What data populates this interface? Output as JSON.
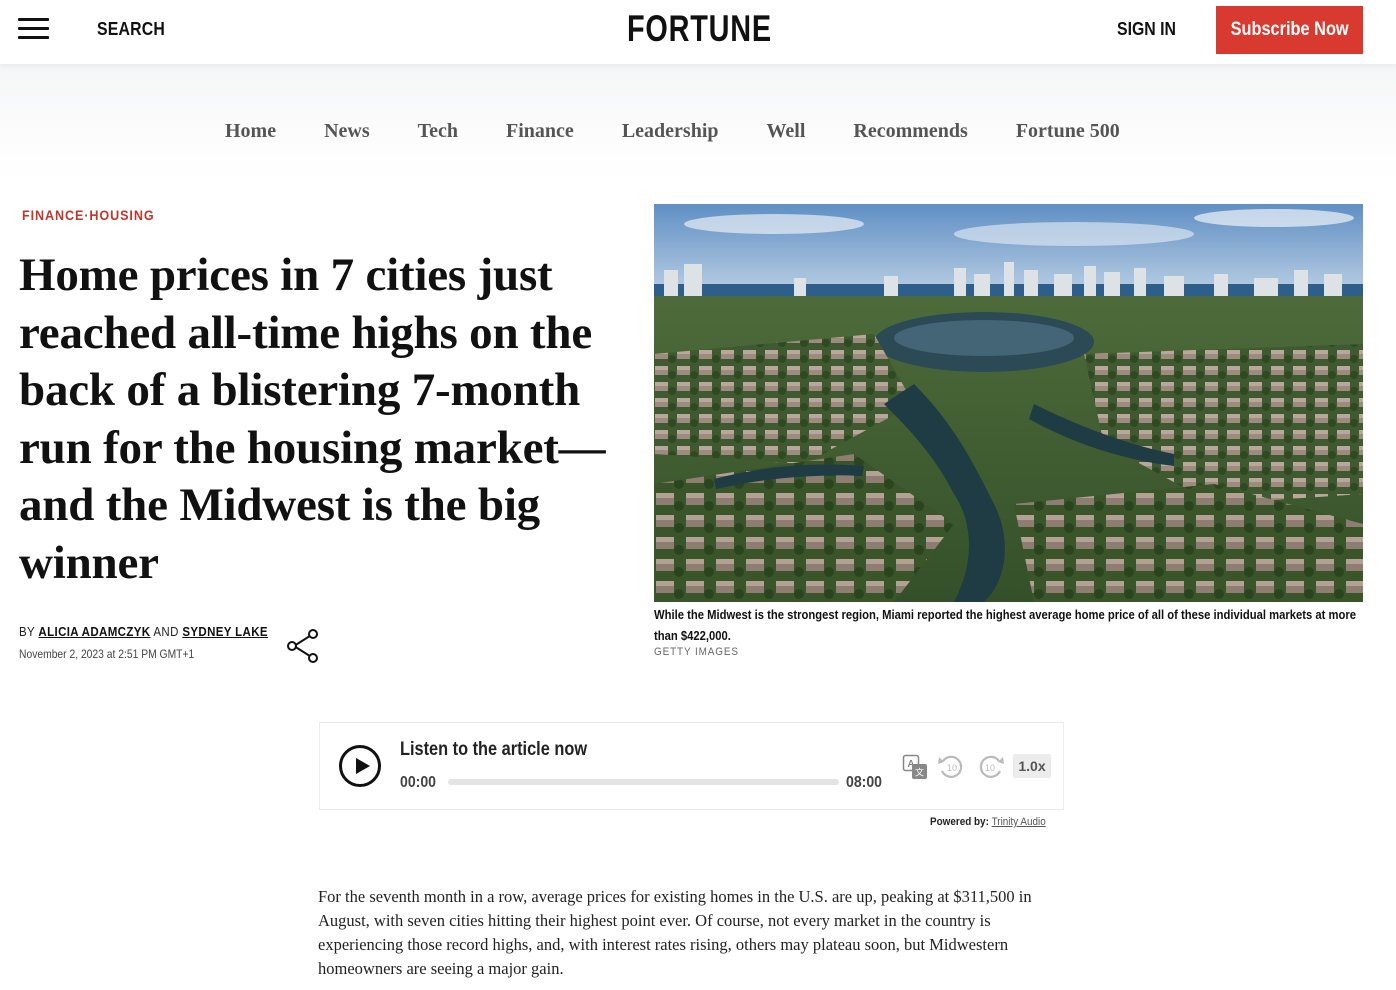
{
  "header": {
    "search_label": "SEARCH",
    "logo": "FORTUNE",
    "sign_in_label": "SIGN IN",
    "subscribe_label": "Subscribe Now",
    "accent_color": "#d93a2f"
  },
  "nav": {
    "items": [
      {
        "label": "Home"
      },
      {
        "label": "News"
      },
      {
        "label": "Tech"
      },
      {
        "label": "Finance"
      },
      {
        "label": "Leadership"
      },
      {
        "label": "Well"
      },
      {
        "label": "Recommends"
      },
      {
        "label": "Fortune 500"
      }
    ]
  },
  "article": {
    "kicker": {
      "section": "FINANCE",
      "separator": "·",
      "topic": "HOUSING"
    },
    "headline": "Home prices in 7 cities just reached all-time highs on the back of a blistering 7-month run for the housing market—and the Midwest is the big winner",
    "byline": {
      "by": "BY",
      "author1": "ALICIA ADAMCZYK",
      "and": "AND",
      "author2": "SYDNEY LAKE",
      "date": "November 2, 2023 at 2:51 PM GMT+1"
    },
    "image": {
      "caption": "While the Midwest is the strongest region, Miami reported the highest average home price of all of these individual markets at more than $422,000.",
      "credit": "GETTY IMAGES"
    },
    "body": "For the seventh month in a row, average prices for existing homes in the U.S. are up, peaking at $311,500 in August, with seven cities hitting their highest point ever. Of course, not every market in the country is experiencing those record highs, and, with interest rates rising, others may plateau soon, but Midwestern homeowners are seeing a major gain."
  },
  "player": {
    "title": "Listen to the article now",
    "current_time": "00:00",
    "duration": "08:00",
    "progress": 0,
    "speed": "1.0x",
    "powered_by_label": "Powered by:",
    "powered_by_link": "Trinity Audio",
    "icons": [
      "translate-icon",
      "rewind-10-icon",
      "forward-10-icon"
    ]
  }
}
